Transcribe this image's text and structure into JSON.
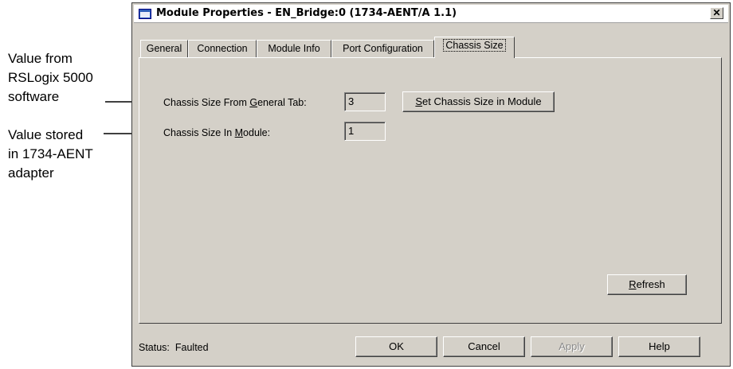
{
  "annotations": {
    "software": [
      "Value from",
      "RSLogix 5000",
      "software"
    ],
    "adapter": [
      "Value stored",
      "in 1734-AENT",
      "adapter"
    ]
  },
  "window": {
    "title": "Module Properties - EN_Bridge:0 (1734-AENT/A 1.1)",
    "close_symbol": "✕"
  },
  "tabs": [
    {
      "label": "General",
      "active": false
    },
    {
      "label": "Connection",
      "active": false
    },
    {
      "label": "Module Info",
      "active": false
    },
    {
      "label": "Port Configuration",
      "active": false
    },
    {
      "label": "Chassis Size",
      "active": true
    }
  ],
  "chassis": {
    "from_general_label_pre": "Chassis Size From ",
    "from_general_label_key": "G",
    "from_general_label_post": "eneral Tab:",
    "from_general_value": "3",
    "in_module_label_pre": "Chassis Size In ",
    "in_module_label_key": "M",
    "in_module_label_post": "odule:",
    "in_module_value": "1",
    "set_button_key": "S",
    "set_button_rest": "et Chassis Size in Module",
    "refresh_key": "R",
    "refresh_rest": "efresh"
  },
  "footer": {
    "status_label": "Status:",
    "status_value": "Faulted",
    "ok": "OK",
    "cancel": "Cancel",
    "apply": "Apply",
    "help": "Help"
  },
  "colors": {
    "dialog_face": "#d4d0c8",
    "title_icon": "#2c5fb8"
  }
}
